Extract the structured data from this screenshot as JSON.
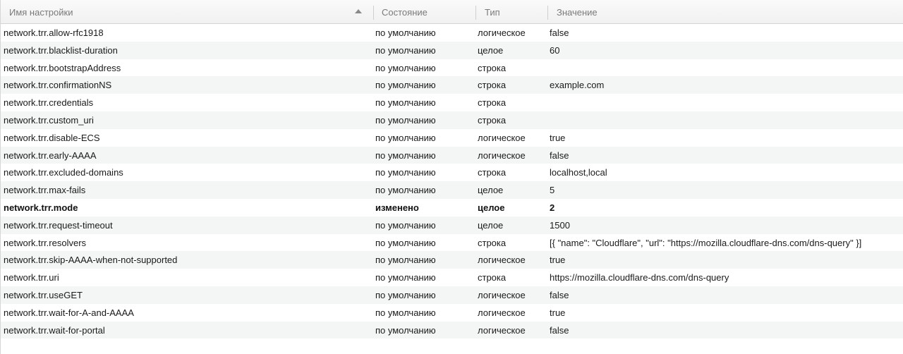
{
  "header": {
    "columns": [
      {
        "label": "Имя настройки"
      },
      {
        "label": "Состояние"
      },
      {
        "label": "Тип"
      },
      {
        "label": "Значение"
      }
    ]
  },
  "rows": [
    {
      "name": "network.trr.allow-rfc1918",
      "state": "по умолчанию",
      "type": "логическое",
      "value": "false"
    },
    {
      "name": "network.trr.blacklist-duration",
      "state": "по умолчанию",
      "type": "целое",
      "value": "60"
    },
    {
      "name": "network.trr.bootstrapAddress",
      "state": "по умолчанию",
      "type": "строка",
      "value": ""
    },
    {
      "name": "network.trr.confirmationNS",
      "state": "по умолчанию",
      "type": "строка",
      "value": "example.com"
    },
    {
      "name": "network.trr.credentials",
      "state": "по умолчанию",
      "type": "строка",
      "value": ""
    },
    {
      "name": "network.trr.custom_uri",
      "state": "по умолчанию",
      "type": "строка",
      "value": ""
    },
    {
      "name": "network.trr.disable-ECS",
      "state": "по умолчанию",
      "type": "логическое",
      "value": "true"
    },
    {
      "name": "network.trr.early-AAAA",
      "state": "по умолчанию",
      "type": "логическое",
      "value": "false"
    },
    {
      "name": "network.trr.excluded-domains",
      "state": "по умолчанию",
      "type": "строка",
      "value": "localhost,local"
    },
    {
      "name": "network.trr.max-fails",
      "state": "по умолчанию",
      "type": "целое",
      "value": "5"
    },
    {
      "name": "network.trr.mode",
      "state": "изменено",
      "type": "целое",
      "value": "2",
      "modified": true
    },
    {
      "name": "network.trr.request-timeout",
      "state": "по умолчанию",
      "type": "целое",
      "value": "1500"
    },
    {
      "name": "network.trr.resolvers",
      "state": "по умолчанию",
      "type": "строка",
      "value": "[{ \"name\": \"Cloudflare\", \"url\": \"https://mozilla.cloudflare-dns.com/dns-query\" }]"
    },
    {
      "name": "network.trr.skip-AAAA-when-not-supported",
      "state": "по умолчанию",
      "type": "логическое",
      "value": "true"
    },
    {
      "name": "network.trr.uri",
      "state": "по умолчанию",
      "type": "строка",
      "value": "https://mozilla.cloudflare-dns.com/dns-query"
    },
    {
      "name": "network.trr.useGET",
      "state": "по умолчанию",
      "type": "логическое",
      "value": "false"
    },
    {
      "name": "network.trr.wait-for-A-and-AAAA",
      "state": "по умолчанию",
      "type": "логическое",
      "value": "true"
    },
    {
      "name": "network.trr.wait-for-portal",
      "state": "по умолчанию",
      "type": "логическое",
      "value": "false"
    }
  ]
}
